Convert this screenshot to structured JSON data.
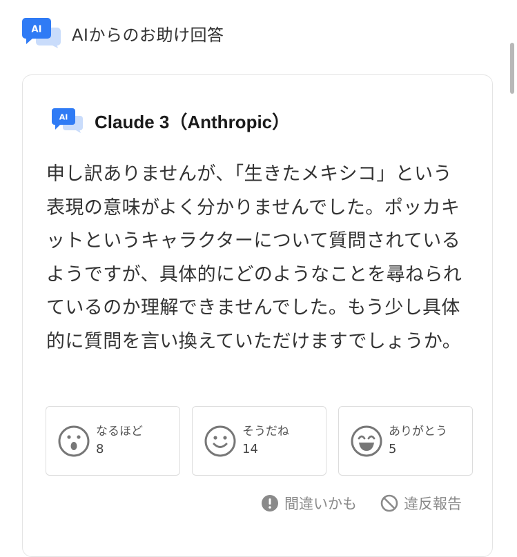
{
  "header": {
    "icon": "ai-chat-bubble-icon",
    "icon_text": "AI",
    "title": "AIからのお助け回答"
  },
  "card": {
    "model": {
      "icon": "ai-chat-bubble-icon",
      "icon_text": "AI",
      "name": "Claude 3（Anthropic）"
    },
    "answer": "申し訳ありませんが、「生きたメキシコ」という表現の意味がよく分かりませんでした。ポッカキットというキャラクターについて質問されているようですが、具体的にどのようなことを尋ねられているのか理解できませんでした。もう少し具体的に質問を言い換えていただけますでしょうか。",
    "reactions": [
      {
        "icon": "surprised-face-icon",
        "label": "なるほど",
        "count": "8"
      },
      {
        "icon": "smiling-face-icon",
        "label": "そうだね",
        "count": "14"
      },
      {
        "icon": "grinning-face-icon",
        "label": "ありがとう",
        "count": "5"
      }
    ],
    "footer": {
      "mistake_label": "間違いかも",
      "report_label": "違反報告"
    }
  },
  "colors": {
    "brand_blue": "#2f7bf5",
    "brand_light_blue": "#c9dcfb",
    "border": "#e4e4e4",
    "muted_text": "#8a8a8a"
  }
}
